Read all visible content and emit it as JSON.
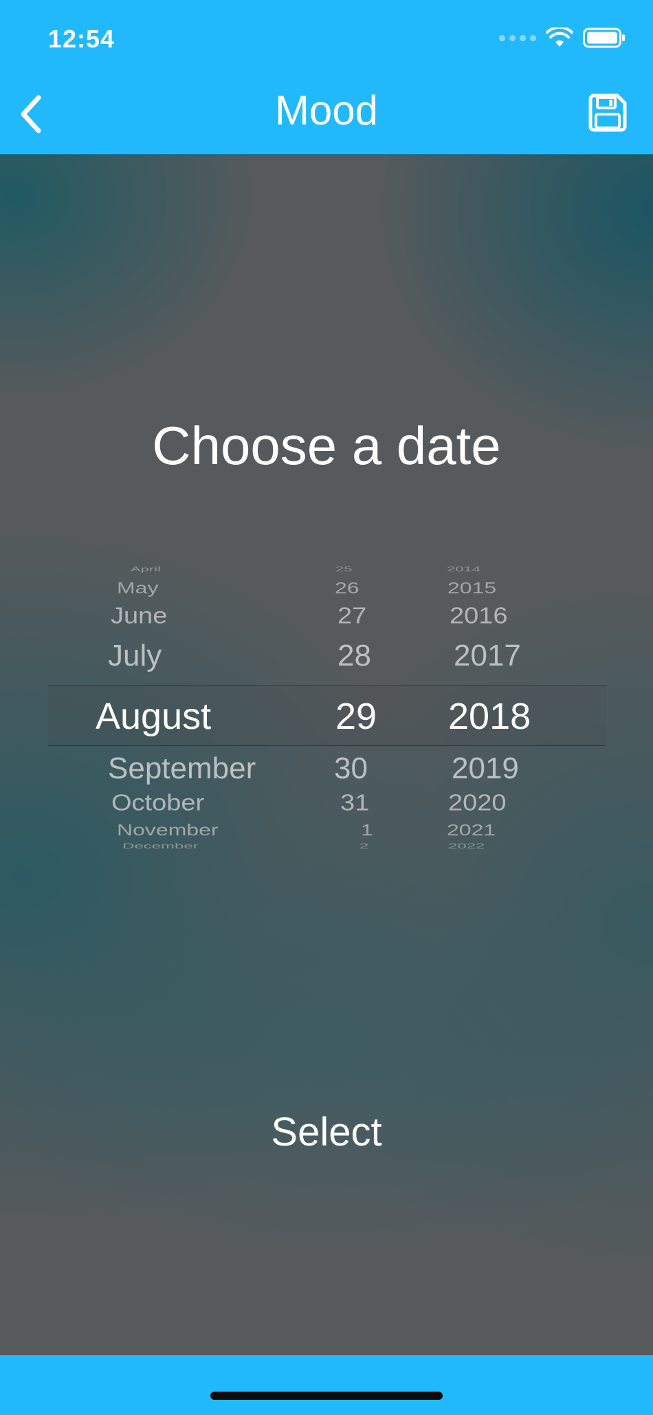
{
  "status_bar": {
    "time": "12:54",
    "wifi_icon": "wifi-icon",
    "battery_icon": "battery-icon"
  },
  "nav": {
    "title": "Mood",
    "back_icon": "chevron-left-icon",
    "save_icon": "floppy-disk-icon"
  },
  "main": {
    "heading": "Choose a date",
    "select_label": "Select"
  },
  "date_picker": {
    "months": [
      "April",
      "May",
      "June",
      "July",
      "August",
      "September",
      "October",
      "November",
      "December"
    ],
    "days": [
      "25",
      "26",
      "27",
      "28",
      "29",
      "30",
      "31",
      "1",
      "2"
    ],
    "years": [
      "2014",
      "2015",
      "2016",
      "2017",
      "2018",
      "2019",
      "2020",
      "2021",
      "2022"
    ],
    "selected": {
      "month": "August",
      "day": "29",
      "year": "2018"
    }
  },
  "colors": {
    "accent": "#21b9fb",
    "background": "#575a5c",
    "text": "#ffffff"
  }
}
